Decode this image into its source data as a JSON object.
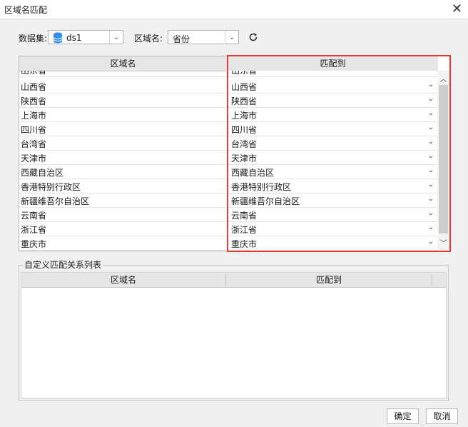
{
  "window": {
    "title": "区域名匹配"
  },
  "toolbar": {
    "dataset_label": "数据集:",
    "dataset_value": "ds1",
    "region_label": "区域名:",
    "region_value": "省份"
  },
  "main_table": {
    "headers": [
      "区域名",
      "匹配到"
    ],
    "partial_row": {
      "name": "山东省",
      "match": "山东省"
    },
    "rows": [
      {
        "name": "山西省",
        "match": "山西省"
      },
      {
        "name": "陕西省",
        "match": "陕西省"
      },
      {
        "name": "上海市",
        "match": "上海市"
      },
      {
        "name": "四川省",
        "match": "四川省"
      },
      {
        "name": "台湾省",
        "match": "台湾省"
      },
      {
        "name": "天津市",
        "match": "天津市"
      },
      {
        "name": "西藏自治区",
        "match": "西藏自治区"
      },
      {
        "name": "香港特别行政区",
        "match": "香港特别行政区"
      },
      {
        "name": "新疆维吾尔自治区",
        "match": "新疆维吾尔自治区"
      },
      {
        "name": "云南省",
        "match": "云南省"
      },
      {
        "name": "浙江省",
        "match": "浙江省"
      },
      {
        "name": "重庆市",
        "match": "重庆市"
      }
    ]
  },
  "custom_group": {
    "title": "自定义匹配关系列表",
    "headers": [
      "区域名",
      "匹配到"
    ]
  },
  "buttons": {
    "ok": "确定",
    "cancel": "取消"
  },
  "colors": {
    "highlight": "#e53935",
    "db_icon": "#2f8ee8"
  }
}
